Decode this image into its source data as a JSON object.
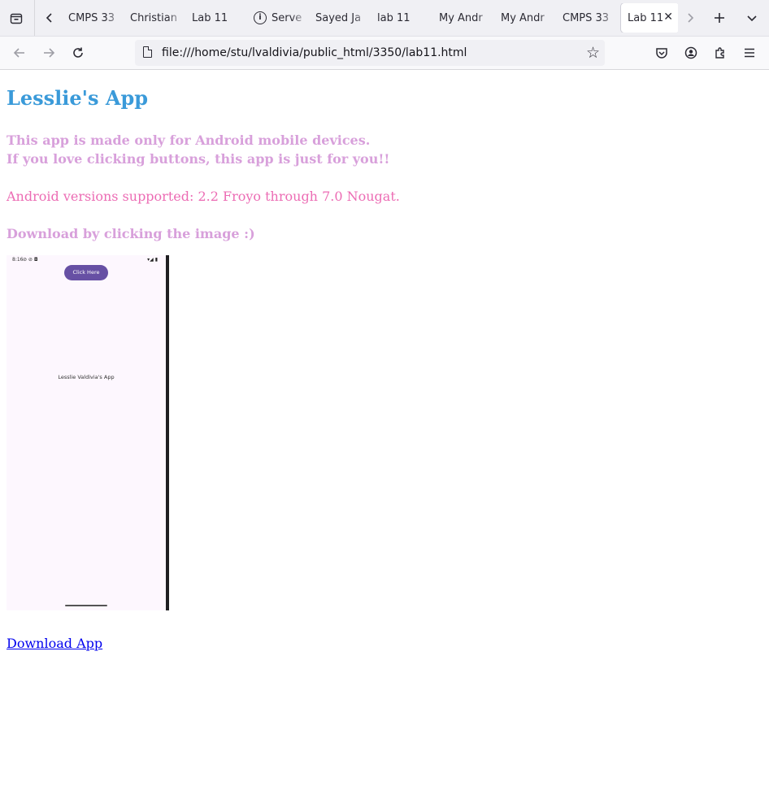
{
  "browser": {
    "tabs": [
      {
        "label": "CMPS 33"
      },
      {
        "label": "Christian"
      },
      {
        "label": "Lab 11"
      },
      {
        "label": "Serve",
        "icon": "info-icon"
      },
      {
        "label": "Sayed Ja"
      },
      {
        "label": "lab 11"
      },
      {
        "label": "My Andr"
      },
      {
        "label": "My Andr"
      },
      {
        "label": "CMPS 33"
      },
      {
        "label": "Lab 11",
        "active": true
      }
    ],
    "url": "file:///home/stu/lvaldivia/public_html/3350/lab11.html"
  },
  "page": {
    "title": "Lesslie's App",
    "intro_line1": "This app is made only for Android mobile devices.",
    "intro_line2": "If you love clicking buttons, this app is just for you!!",
    "versions": "Android versions supported: 2.2 Froyo through 7.0 Nougat.",
    "download_hint": "Download by clicking the image :)",
    "download_link": "Download App",
    "phone": {
      "time": "8:16",
      "button_label": "Click Here",
      "app_label": "Lesslie Valdivia's App"
    }
  },
  "colors": {
    "title": "#3a9ad9",
    "lavender_text": "#d8a0db",
    "pink_text": "#ec6cb4",
    "link": "#0000ee",
    "phone_button": "#6750a4"
  }
}
